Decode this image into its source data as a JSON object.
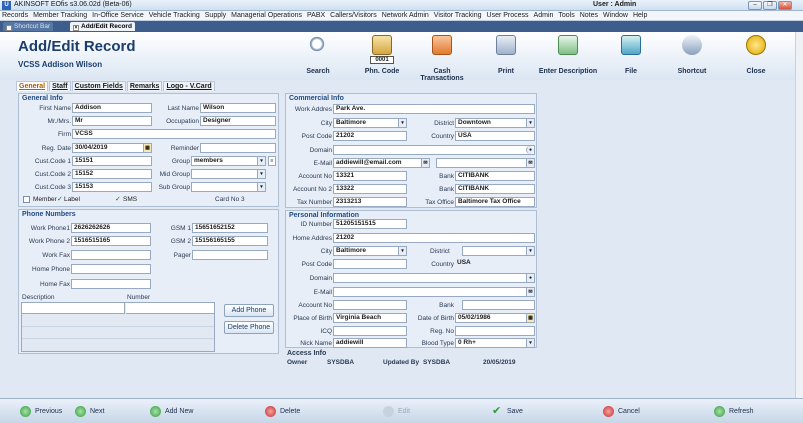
{
  "window": {
    "title": "AKINSOFT EOfis s3.06.02d (Beta-06)",
    "user": "User : Admin"
  },
  "menu": [
    "Records",
    "Member Tracking",
    "In-Office Service",
    "Vehicle Tracking",
    "Supply",
    "Managerial Operations",
    "PABX",
    "Callers/Visitors",
    "Network Admin",
    "Visitor Tracking",
    "User Process",
    "Admin",
    "Tools",
    "Notes",
    "Window",
    "Help"
  ],
  "tabs": {
    "shortcut": "Shortcut Bar",
    "addedit": "Add/Edit Record"
  },
  "header": {
    "title": "Add/Edit Record",
    "subtitle": "VCSS Addison Wilson"
  },
  "toolbar": {
    "search": "Search",
    "phn_code": "Phn. Code",
    "phn_number": "0001",
    "cash": "Cash Transactions",
    "print": "Print",
    "enter_desc": "Enter Description",
    "file": "File",
    "shortcut": "Shortcut",
    "close": "Close"
  },
  "subtabs": [
    "General",
    "Staff",
    "Custom Fields",
    "Remarks",
    "Logo - V.Card"
  ],
  "general": {
    "title": "General Info",
    "first_name_lbl": "First Name",
    "first_name": "Addison",
    "last_name_lbl": "Last Name",
    "last_name": "Wilson",
    "mr_lbl": "Mr./Mrs.",
    "mr": "Mr",
    "occupation_lbl": "Occupation",
    "occupation": "Designer",
    "firm_lbl": "Firm",
    "firm": "VCSS",
    "reg_date_lbl": "Reg. Date",
    "reg_date": "30/04/2019",
    "reminder_lbl": "Reminder",
    "code1_lbl": "Cust.Code 1",
    "code1": "15151",
    "group_lbl": "Group",
    "group": "members",
    "code2_lbl": "Cust.Code 2",
    "code2": "15152",
    "midgroup_lbl": "Mid Group",
    "code3_lbl": "Cust.Code 3",
    "code3": "15153",
    "subgroup_lbl": "Sub Group",
    "member": "Member",
    "label": "Label",
    "sms": "SMS",
    "card": "Card No 3"
  },
  "phones": {
    "title": "Phone Numbers",
    "wp1_lbl": "Work Phone1",
    "wp1": "2626262626",
    "gsm1_lbl": "GSM 1",
    "gsm1": "15651652152",
    "wp2_lbl": "Work Phone 2",
    "wp2": "1516515165",
    "gsm2_lbl": "GSM 2",
    "gsm2": "15156165155",
    "wfax_lbl": "Work Fax",
    "pager_lbl": "Pager",
    "hphone_lbl": "Home Phone",
    "hfax_lbl": "Home Fax",
    "desc_lbl": "Description",
    "num_lbl": "Number",
    "add": "Add Phone",
    "del": "Delete Phone"
  },
  "commercial": {
    "title": "Commercial Info",
    "addr_lbl": "Work Addres",
    "addr": "Park Ave.",
    "city_lbl": "City",
    "city": "Baltimore",
    "district_lbl": "District",
    "district": "Downtown",
    "post_lbl": "Post Code",
    "post": "21202",
    "country_lbl": "Country",
    "country": "USA",
    "domain_lbl": "Domain",
    "email_lbl": "E-Mail",
    "email": "addiewill@email.com",
    "acc1_lbl": "Account No",
    "acc1": "13321",
    "bank1_lbl": "Bank",
    "bank1": "CITIBANK",
    "acc2_lbl": "Account No 2",
    "acc2": "13322",
    "bank2_lbl": "Bank",
    "bank2": "CITIBANK",
    "tax_lbl": "Tax Number",
    "tax": "2313213",
    "taxoff_lbl": "Tax Office",
    "taxoff": "Baltimore Tax Office"
  },
  "personal": {
    "title": "Personal Information",
    "id_lbl": "ID Number",
    "id": "51205151515",
    "addr_lbl": "Home Addres",
    "addr": "21202",
    "city_lbl": "City",
    "city": "Baltimore",
    "district_lbl": "District",
    "post_lbl": "Post Code",
    "country_lbl": "Country",
    "country": "USA",
    "domain_lbl": "Domain",
    "email_lbl": "E-Mail",
    "acc_lbl": "Account No",
    "bank_lbl": "Bank",
    "pob_lbl": "Place of Birth",
    "pob": "Virginia Beach",
    "dob_lbl": "Date of Birth",
    "dob": "05/02/1986",
    "icq_lbl": "ICQ",
    "reg_lbl": "Reg. No",
    "nick_lbl": "Nick Name",
    "nick": "addiewill",
    "blood_lbl": "Blood Type",
    "blood": "0 Rh+"
  },
  "access": {
    "title": "Access Info",
    "owner_lbl": "Owner",
    "owner": "SYSDBA",
    "upd_lbl": "Updated By",
    "upd": "SYSDBA",
    "date": "20/05/2019"
  },
  "bottom": {
    "prev": "Previous",
    "next": "Next",
    "addnew": "Add New",
    "delete": "Delete",
    "edit": "Edit",
    "save": "Save",
    "cancel": "Cancel",
    "refresh": "Refresh"
  }
}
